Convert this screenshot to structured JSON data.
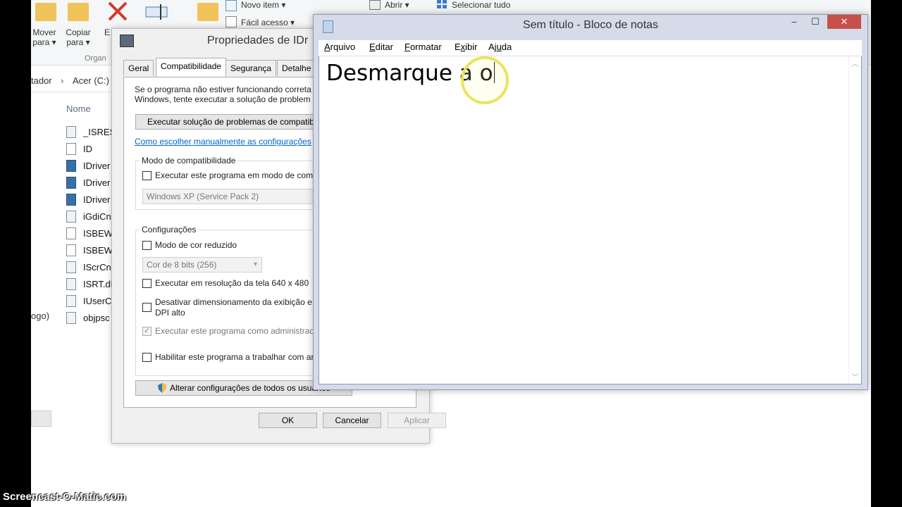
{
  "ribbon": {
    "move_to": "Mover\npara ▾",
    "copy_to": "Copiar\npara ▾",
    "delete_partial": "E",
    "new_item": "Novo item ▾",
    "easy_access": "Fácil acesso ▾",
    "open": "Abrir ▾",
    "select_all": "Selecionar tudo",
    "group_organize": "Organ"
  },
  "explorer": {
    "breadcrumb_left": "tador",
    "breadcrumb_drive": "Acer (C:)",
    "column_name": "Nome",
    "sidebar_partial": "ogo)",
    "files": [
      {
        "name": "_ISRES",
        "kind": "dll"
      },
      {
        "name": "ID",
        "kind": "file"
      },
      {
        "name": "IDriver",
        "kind": "exe"
      },
      {
        "name": "IDriver",
        "kind": "exe"
      },
      {
        "name": "IDriver",
        "kind": "exe"
      },
      {
        "name": "iGdiCn",
        "kind": "dll"
      },
      {
        "name": "ISBEW",
        "kind": "app"
      },
      {
        "name": "ISBEW",
        "kind": "file"
      },
      {
        "name": "IScrCn",
        "kind": "dll"
      },
      {
        "name": "ISRT.dl",
        "kind": "dll"
      },
      {
        "name": "IUserC",
        "kind": "dll"
      },
      {
        "name": "objpsc",
        "kind": "dll"
      }
    ]
  },
  "properties": {
    "title": "Propriedades de IDr",
    "tabs": [
      "Geral",
      "Compatibilidade",
      "Segurança",
      "Detalhe"
    ],
    "intro_line1": "Se o programa não estiver funcionando correta",
    "intro_line2": "Windows, tente executar a solução de problem",
    "troubleshoot_button": "Executar solução de problemas de compatib",
    "manual_link": "Como escolher manualmente as configurações",
    "compat_mode_title": "Modo de compatibilidade",
    "compat_mode_check": "Executar este programa em modo de comp",
    "compat_mode_select": "Windows XP (Service Pack 2)",
    "settings_title": "Configurações",
    "reduced_color": "Modo de cor reduzido",
    "color_select": "Cor de 8 bits (256)",
    "resolution_640": "Executar em resolução da tela 640 x 480",
    "disable_dpi_line1": "Desativar dimensionamento da exibição e",
    "disable_dpi_line2": "DPI alto",
    "run_as_admin": "Executar este programa como administrad",
    "enable_network": "Habilitar este programa a trabalhar com ar",
    "change_all_users": "Alterar configurações de todos os usuários",
    "ok": "OK",
    "cancel": "Cancelar",
    "apply": "Aplicar"
  },
  "notepad": {
    "title": "Sem título - Bloco de notas",
    "minimize": "–",
    "maximize": "☐",
    "close": "✕",
    "menu": [
      {
        "pre": "",
        "key": "A",
        "post": "rquivo"
      },
      {
        "pre": "",
        "key": "E",
        "post": "ditar"
      },
      {
        "pre": "",
        "key": "F",
        "post": "ormatar"
      },
      {
        "pre": "E",
        "key": "x",
        "post": "ibir"
      },
      {
        "pre": "Aj",
        "key": "u",
        "post": "da"
      }
    ],
    "content": "Desmarque a o"
  },
  "watermark": "Screencast-O-Matic.com"
}
